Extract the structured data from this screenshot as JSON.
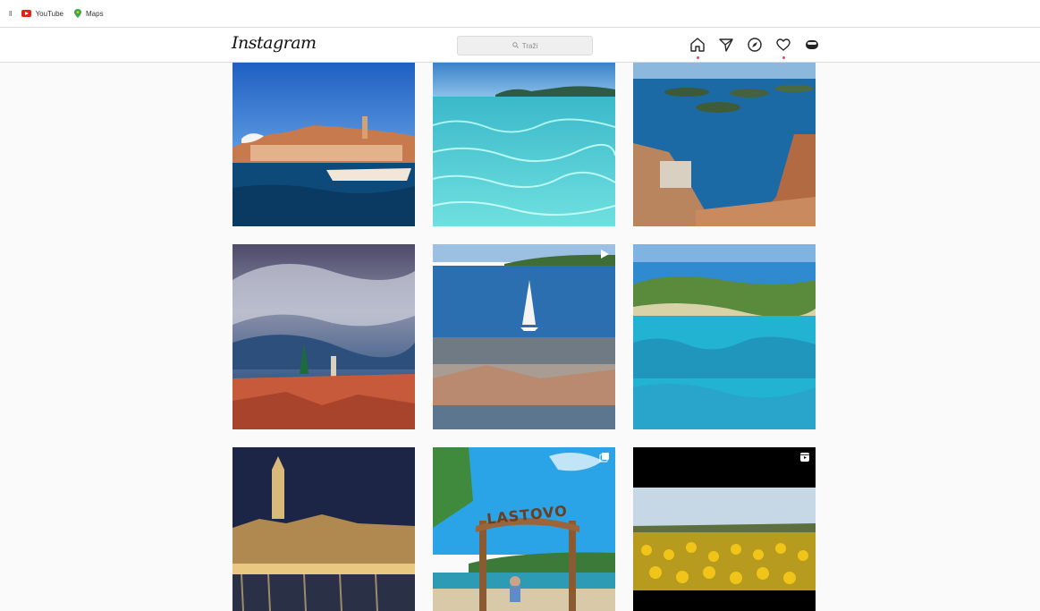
{
  "bookmarks": {
    "apps_label": "ll",
    "items": [
      {
        "label": "YouTube",
        "icon": "youtube-icon"
      },
      {
        "label": "Maps",
        "icon": "maps-icon"
      }
    ]
  },
  "header": {
    "logo": "Instagram",
    "search_placeholder": "Traži",
    "nav_icons": [
      "home-icon",
      "direct-icon",
      "explore-icon",
      "activity-icon",
      "profile-avatar"
    ]
  },
  "grid": {
    "posts": [
      {
        "subject": "coastal-town",
        "type": "photo"
      },
      {
        "subject": "turquoise-sea",
        "type": "photo"
      },
      {
        "subject": "islands-harbor",
        "type": "photo"
      },
      {
        "subject": "cathedral-clouds",
        "type": "photo"
      },
      {
        "subject": "sailboat-town",
        "type": "video"
      },
      {
        "subject": "lagoon-islands",
        "type": "photo"
      },
      {
        "subject": "night-cathedral",
        "type": "photo"
      },
      {
        "subject": "lastovo-swing",
        "type": "carousel",
        "sign_text": "LASTOVO"
      },
      {
        "subject": "sunflower-field",
        "type": "reel"
      }
    ]
  },
  "colors": {
    "accent": "#ed4956",
    "header_bg": "#ffffff",
    "page_bg": "#fafafa"
  }
}
